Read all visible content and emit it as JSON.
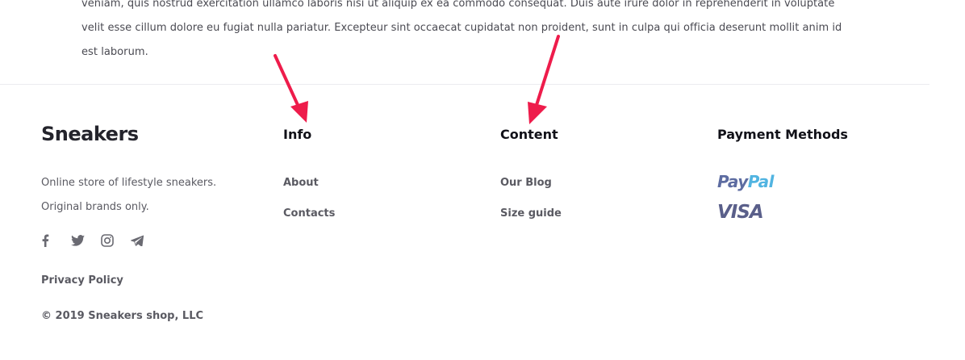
{
  "body_text": {
    "lines": [
      "veniam, quis nostrud exercitation ullamco laboris nisi ut aliquip ex ea commodo consequat. Duis aute irure dolor in reprehenderit in voluptate",
      "velit esse cillum dolore eu fugiat nulla pariatur. Excepteur sint occaecat cupidatat non proident, sunt in culpa qui officia deserunt mollit anim id",
      "est laborum."
    ]
  },
  "footer": {
    "brand": {
      "title": "Sneakers",
      "desc_line1": "Online store of lifestyle sneakers.",
      "desc_line2": "Original brands only.",
      "socials": [
        "facebook-icon",
        "twitter-icon",
        "instagram-icon",
        "telegram-icon"
      ],
      "privacy": "Privacy Policy",
      "copyright": "© 2019 Sneakers shop, LLC"
    },
    "info": {
      "heading": "Info",
      "links": [
        "About",
        "Contacts"
      ]
    },
    "content": {
      "heading": "Content",
      "links": [
        "Our Blog",
        "Size guide"
      ]
    },
    "payment": {
      "heading": "Payment Methods",
      "paypal_part1": "Pay",
      "paypal_part2": "Pal",
      "visa": "VISA"
    }
  },
  "colors": {
    "annotation_arrow": "#ee1c4b",
    "text_dark": "#111118",
    "text_muted": "#5a5a62"
  }
}
